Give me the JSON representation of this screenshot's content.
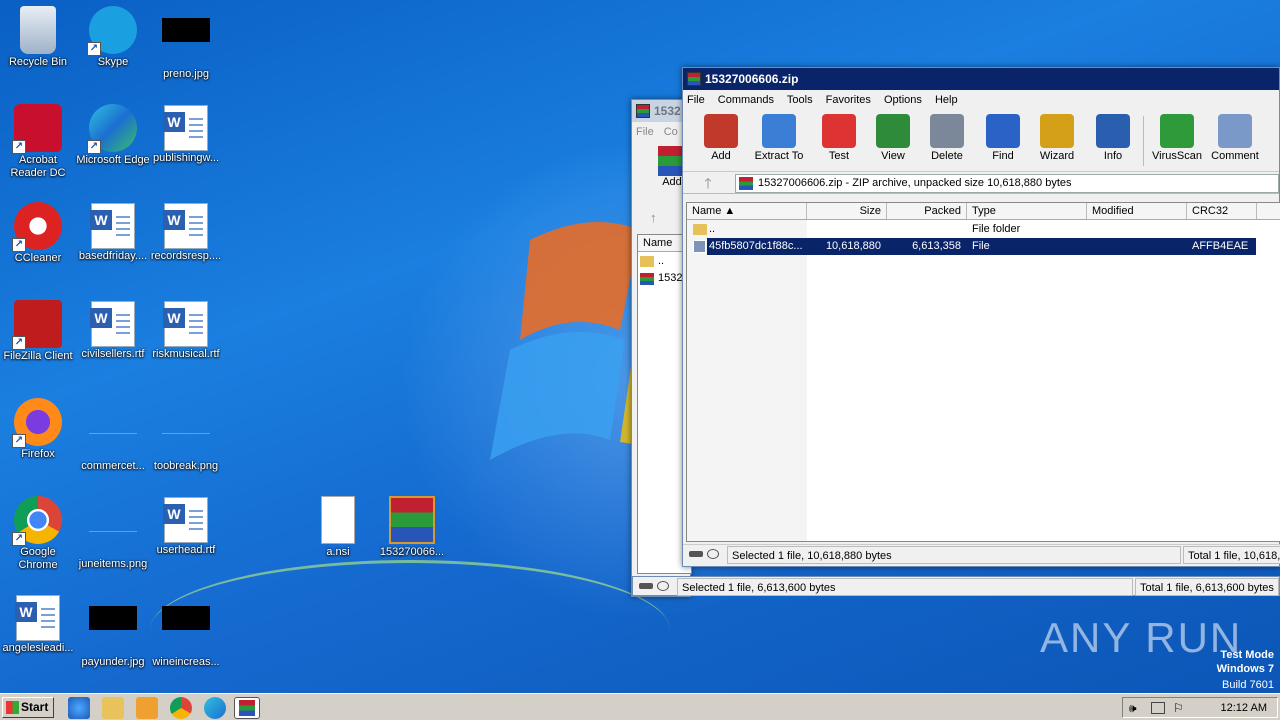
{
  "desktop": {
    "icons": [
      {
        "label": "Recycle Bin",
        "icon": "recycle-bin-icon"
      },
      {
        "label": "Skype",
        "icon": "skype-icon"
      },
      {
        "label": "preno.jpg",
        "icon": "image-thumbnail-icon"
      },
      {
        "label": "Acrobat Reader DC",
        "icon": "acrobat-icon"
      },
      {
        "label": "Microsoft Edge",
        "icon": "edge-icon"
      },
      {
        "label": "publishingw...",
        "icon": "word-document-icon"
      },
      {
        "label": "CCleaner",
        "icon": "ccleaner-icon"
      },
      {
        "label": "basedfriday....",
        "icon": "word-document-icon"
      },
      {
        "label": "recordsresp....",
        "icon": "word-document-icon"
      },
      {
        "label": "FileZilla Client",
        "icon": "filezilla-icon"
      },
      {
        "label": "civilsellers.rtf",
        "icon": "word-document-icon"
      },
      {
        "label": "riskmusical.rtf",
        "icon": "word-document-icon"
      },
      {
        "label": "Firefox",
        "icon": "firefox-icon"
      },
      {
        "label": "commercet...",
        "icon": "image-thumbnail-icon"
      },
      {
        "label": "toobreak.png",
        "icon": "image-thumbnail-icon"
      },
      {
        "label": "Google Chrome",
        "icon": "chrome-icon"
      },
      {
        "label": "juneitems.png",
        "icon": "image-thumbnail-icon"
      },
      {
        "label": "userhead.rtf",
        "icon": "word-document-icon"
      },
      {
        "label": "a.nsi",
        "icon": "blank-file-icon"
      },
      {
        "label": "153270066...",
        "icon": "winrar-archive-icon"
      },
      {
        "label": "angelesleadi...",
        "icon": "word-document-icon"
      },
      {
        "label": "payunder.jpg",
        "icon": "image-thumbnail-icon"
      },
      {
        "label": "wineincreas...",
        "icon": "image-thumbnail-icon"
      }
    ]
  },
  "back_window": {
    "title": "1532",
    "menu": [
      "File",
      "Co"
    ],
    "add_label": "Add",
    "col_name": "Name",
    "rows": [
      "..",
      "1532"
    ],
    "status_left": "Selected 1 file, 6,613,600 bytes",
    "status_right": "Total 1 file, 6,613,600 bytes"
  },
  "front_window": {
    "title": "15327006606.zip",
    "menu": [
      "File",
      "Commands",
      "Tools",
      "Favorites",
      "Options",
      "Help"
    ],
    "toolbar": [
      {
        "label": "Add",
        "icon": "add-archive-icon",
        "color": "#c0392b"
      },
      {
        "label": "Extract To",
        "icon": "extract-folder-icon",
        "color": "#3a7fd5"
      },
      {
        "label": "Test",
        "icon": "test-clipboard-icon",
        "color": "#d33"
      },
      {
        "label": "View",
        "icon": "view-book-icon",
        "color": "#2e8b3a"
      },
      {
        "label": "Delete",
        "icon": "delete-trash-icon",
        "color": "#7a8899"
      },
      {
        "label": "Find",
        "icon": "find-magnifier-icon",
        "color": "#2a63c5"
      },
      {
        "label": "Wizard",
        "icon": "wizard-wand-icon",
        "color": "#d4a017"
      },
      {
        "label": "Info",
        "icon": "info-icon",
        "color": "#2a5fb0"
      },
      {
        "label": "VirusScan",
        "icon": "virusscan-icon",
        "color": "#2e9a3a"
      },
      {
        "label": "Comment",
        "icon": "comment-icon",
        "color": "#7a98c8"
      }
    ],
    "address": "15327006606.zip - ZIP archive, unpacked size 10,618,880 bytes",
    "columns": [
      "Name",
      "Size",
      "Packed",
      "Type",
      "Modified",
      "CRC32"
    ],
    "rows": [
      {
        "name": "..",
        "size": "",
        "packed": "",
        "type": "File folder",
        "modified": "",
        "crc": ""
      },
      {
        "name": "45fb5807dc1f88c...",
        "size": "10,618,880",
        "packed": "6,613,358",
        "type": "File",
        "modified": "",
        "crc": "AFFB4EAE"
      }
    ],
    "status_left": "Selected 1 file, 10,618,880 bytes",
    "status_right": "Total 1 file, 10,618,"
  },
  "taskbar": {
    "start_label": "Start",
    "clock": "12:12 AM"
  },
  "watermark": "ANY RUN",
  "test_mode": {
    "line1": "Test Mode",
    "line2": "Windows 7",
    "line3": "Build 7601"
  }
}
